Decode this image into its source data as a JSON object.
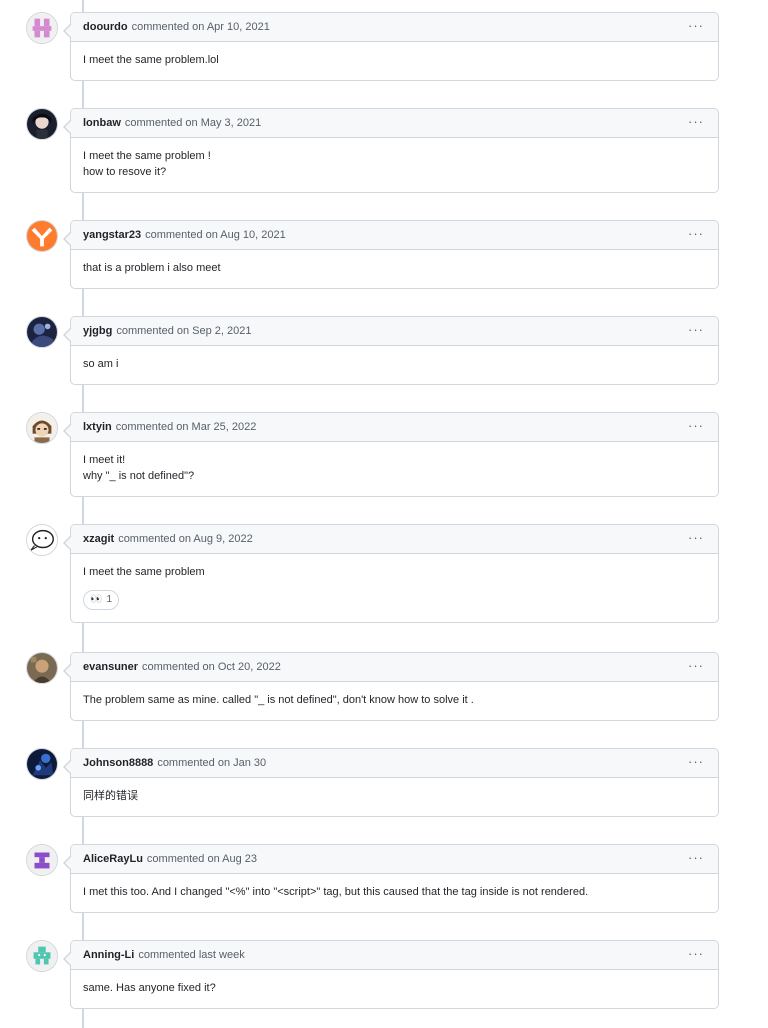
{
  "comments": [
    {
      "author": "doourdo",
      "meta": "commented on Apr 10, 2021",
      "lines": [
        "I meet the same problem.lol"
      ]
    },
    {
      "author": "lonbaw",
      "meta": "commented on May 3, 2021",
      "lines": [
        "I meet the same problem !",
        "how to resove it?"
      ]
    },
    {
      "author": "yangstar23",
      "meta": "commented on Aug 10, 2021",
      "lines": [
        "that is a problem i also meet"
      ]
    },
    {
      "author": "yjgbg",
      "meta": "commented on Sep 2, 2021",
      "lines": [
        "so am i"
      ]
    },
    {
      "author": "lxtyin",
      "meta": "commented on Mar 25, 2022",
      "lines": [
        "I meet it!",
        "why \"_ is not defined\"?"
      ]
    },
    {
      "author": "xzagit",
      "meta": "commented on Aug 9, 2022",
      "lines": [
        "I meet the same problem"
      ],
      "reaction": {
        "emoji": "eyes-icon",
        "glyph": "👀",
        "count": "1"
      }
    },
    {
      "author": "evansuner",
      "meta": "commented on Oct 20, 2022",
      "lines": [
        "The problem same as mine. called \"_ is not defined\", don't know how to solve it ."
      ]
    },
    {
      "author": "Johnson8888",
      "meta": "commented on Jan 30",
      "lines": [
        "同样的错误"
      ]
    },
    {
      "author": "AliceRayLu",
      "meta": "commented on Aug 23",
      "lines": [
        "I met this too. And I changed \"<%\" into \"<script>\" tag, but this caused that the tag inside is not rendered."
      ]
    },
    {
      "author": "Anning-Li",
      "meta": "commented last week",
      "lines": [
        "same. Has anyone fixed it?"
      ]
    }
  ],
  "menu_icon": "kebab-horizontal-icon",
  "menu_glyph": "···",
  "colors": {
    "border": "#d0d7de",
    "header_bg": "#f6f8fa",
    "text": "#1f2328",
    "muted": "#57606a"
  }
}
